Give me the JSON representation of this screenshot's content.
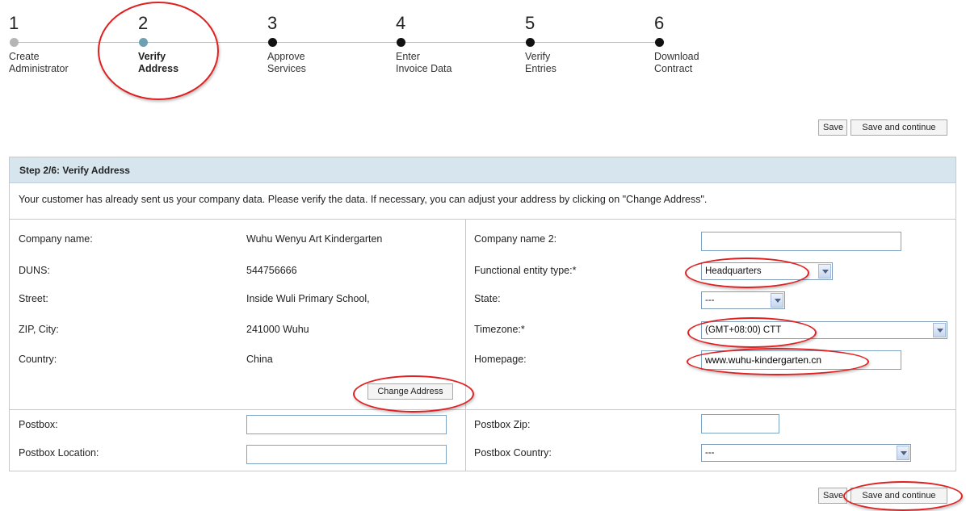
{
  "steps": [
    {
      "num": "1",
      "label": "Create\nAdministrator"
    },
    {
      "num": "2",
      "label": "Verify\nAddress"
    },
    {
      "num": "3",
      "label": "Approve\nServices"
    },
    {
      "num": "4",
      "label": "Enter\nInvoice Data"
    },
    {
      "num": "5",
      "label": "Verify\nEntries"
    },
    {
      "num": "6",
      "label": "Download\nContract"
    }
  ],
  "buttons": {
    "save": "Save",
    "save_continue": "Save and continue",
    "change_address": "Change Address"
  },
  "panel": {
    "title": "Step 2/6: Verify Address",
    "intro": "Your customer has already sent us your company data. Please verify the data. If necessary, you can adjust your address by clicking on \"Change Address\"."
  },
  "left_fields": [
    {
      "label": "Company name:",
      "value": "Wuhu Wenyu Art Kindergarten"
    },
    {
      "label": "DUNS:",
      "value": "544756666"
    },
    {
      "label": "Street:",
      "value": "Inside Wuli Primary School,"
    },
    {
      "label": "ZIP, City:",
      "value": "241000 Wuhu"
    },
    {
      "label": "Country:",
      "value": "China"
    }
  ],
  "right_fields": {
    "company_name_2": {
      "label": "Company name 2:",
      "value": ""
    },
    "entity_type": {
      "label": "Functional entity type:*",
      "value": "Headquarters"
    },
    "state": {
      "label": "State:",
      "value": "---"
    },
    "timezone": {
      "label": "Timezone:*",
      "value": "(GMT+08:00) CTT"
    },
    "homepage": {
      "label": "Homepage:",
      "value": "www.wuhu-kindergarten.cn"
    }
  },
  "postbox": {
    "postbox": {
      "label": "Postbox:",
      "value": ""
    },
    "location": {
      "label": "Postbox Location:",
      "value": ""
    },
    "zip": {
      "label": "Postbox Zip:",
      "value": ""
    },
    "country": {
      "label": "Postbox Country:",
      "value": "---"
    }
  },
  "colors": {
    "panel_header": "#d7e5ee",
    "current_step_dot": "#6f9fb3",
    "highlight_ring": "#e02020"
  }
}
